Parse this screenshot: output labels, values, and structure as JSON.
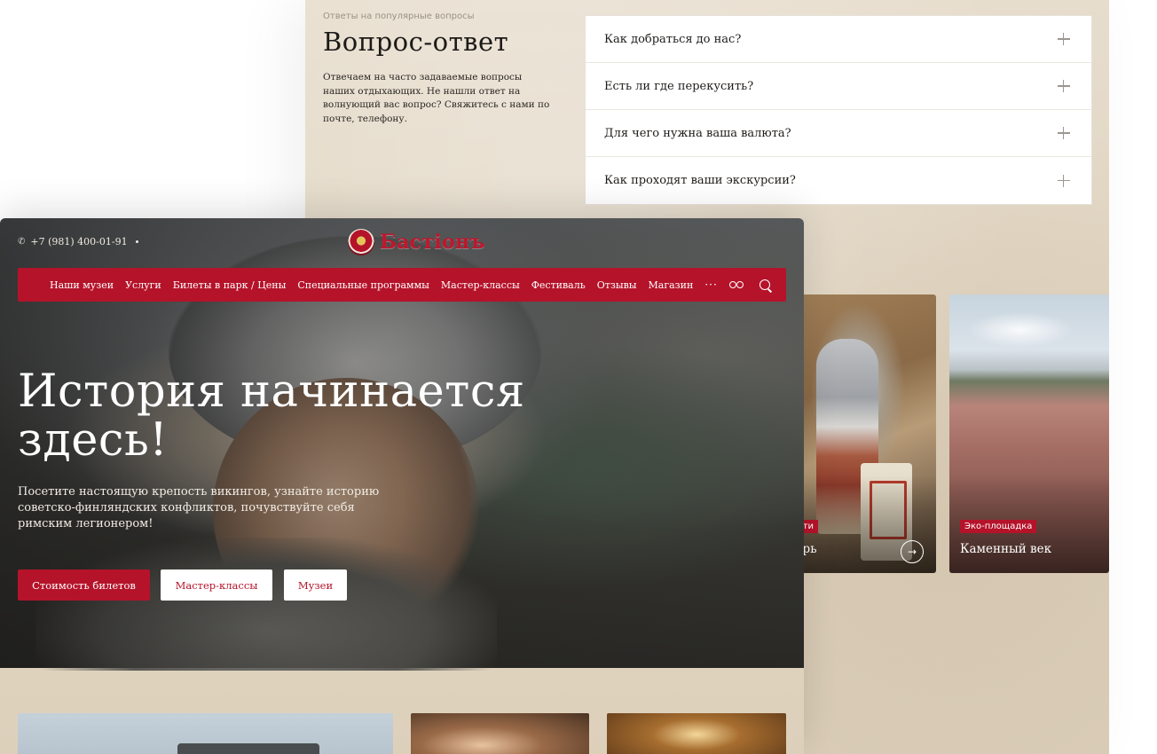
{
  "faq": {
    "kicker": "Ответы на популярные вопросы",
    "title": "Вопрос-ответ",
    "description": "Отвечаем на часто задаваемые вопросы наших отдыхающих. Не нашли ответ на волнующий вас вопрос? Свяжитесь с нами по почте, телефону.",
    "items": [
      {
        "question": "Как добраться до нас?"
      },
      {
        "question": "Есть ли где перекусить?"
      },
      {
        "question": "Для чего нужна ваша валюта?"
      },
      {
        "question": "Как проходят ваши экскурсии?"
      }
    ]
  },
  "cards": [
    {
      "badge": "...ачности",
      "title": "...лагерь",
      "icon": "arrow-right-icon"
    },
    {
      "badge": "Эко-площадка",
      "title": "Каменный век"
    }
  ],
  "header": {
    "phone": "+7 (981) 400-01-91",
    "logo_text": "Бастіонъ"
  },
  "nav": {
    "items": [
      {
        "label": "Наши музеи"
      },
      {
        "label": "Услуги"
      },
      {
        "label": "Билеты в парк / Цены"
      },
      {
        "label": "Специальные программы"
      },
      {
        "label": "Мастер-классы"
      },
      {
        "label": "Фестиваль"
      },
      {
        "label": "Отзывы"
      },
      {
        "label": "Магазин"
      }
    ],
    "more_label": "···"
  },
  "hero": {
    "title": "История начинается здесь!",
    "subtitle": "Посетите настоящую крепость викингов, узнайте историю советско-финляндских конфликтов, почувствуйте себя римским легионером!",
    "buttons": {
      "primary": "Стоимость билетов",
      "secondary1": "Мастер-классы",
      "secondary2": "Музеи"
    }
  },
  "colors": {
    "accent": "#b5132a",
    "paper": "#e3d8c6"
  }
}
